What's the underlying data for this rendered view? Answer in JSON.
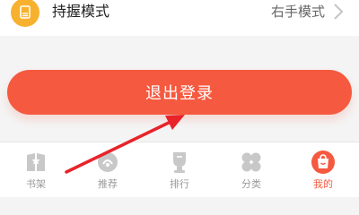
{
  "settings_row": {
    "icon": "hand-grip-icon",
    "label": "持握模式",
    "value": "右手模式",
    "chevron_icon": "chevron-right-icon"
  },
  "logout_button": {
    "label": "退出登录"
  },
  "tab_bar": {
    "items": [
      {
        "label": "书架",
        "icon": "bookshelf-icon",
        "active": false
      },
      {
        "label": "推荐",
        "icon": "recommend-icon",
        "active": false
      },
      {
        "label": "排行",
        "icon": "ranking-icon",
        "active": false
      },
      {
        "label": "分类",
        "icon": "category-icon",
        "active": false
      },
      {
        "label": "我的",
        "icon": "profile-icon",
        "active": true
      }
    ]
  },
  "colors": {
    "accent": "#f5593f",
    "icon_yellow": "#f7b12e",
    "inactive": "#c8c8c8",
    "annotation": "#e8232a"
  }
}
